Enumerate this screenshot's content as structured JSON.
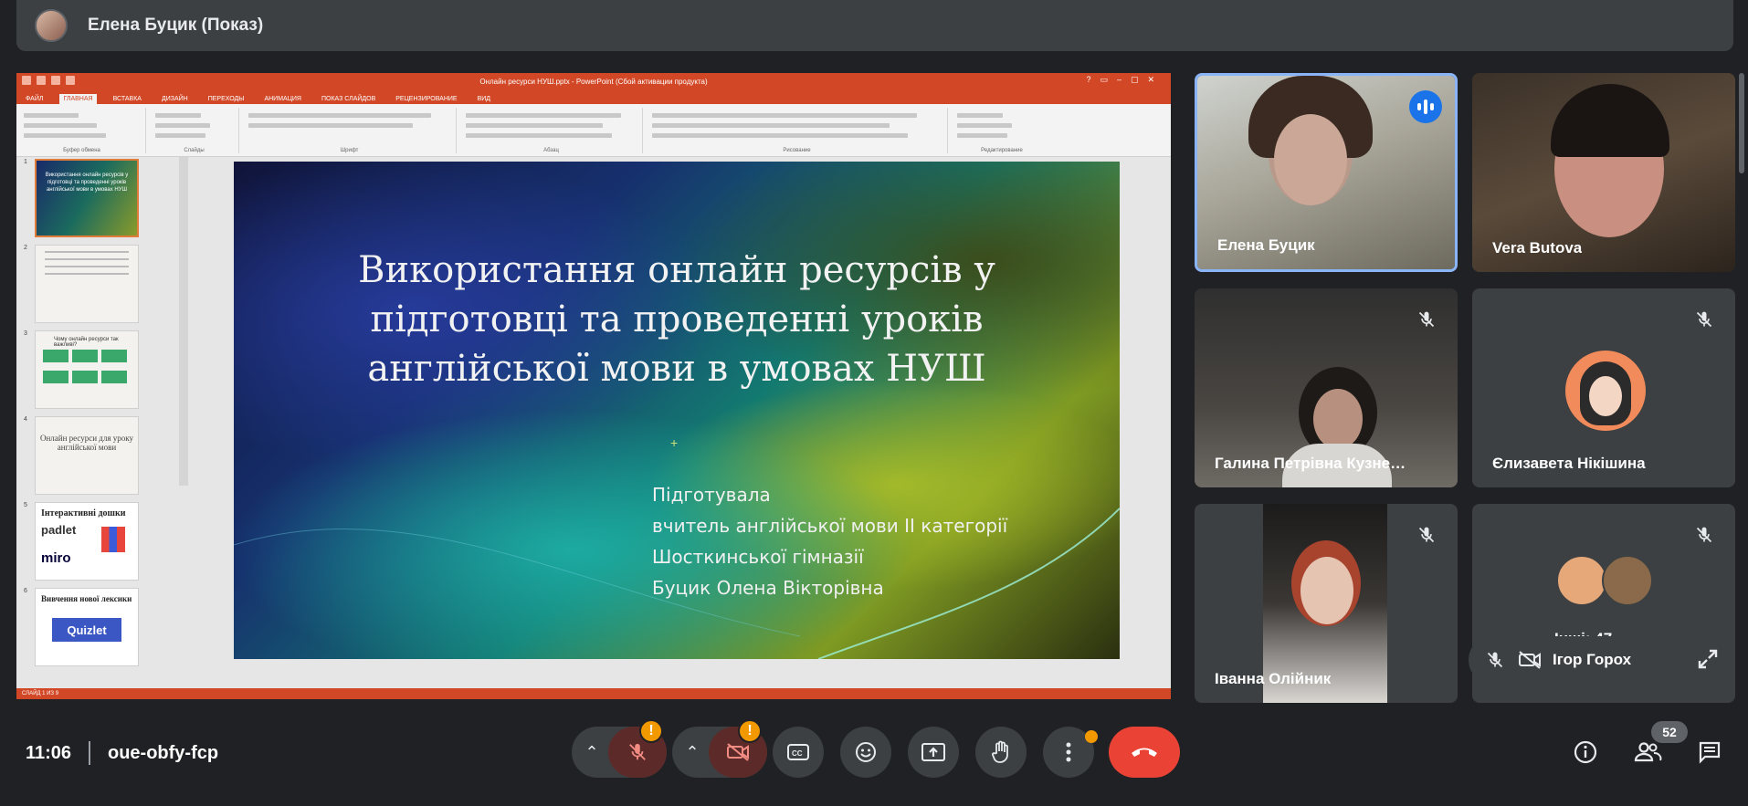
{
  "presenter": {
    "name": "Елена Буцик (Показ)"
  },
  "powerpoint": {
    "window_title": "Онлайн ресурси НУШ.pptx - PowerPoint (Сбой активации продукта)",
    "tabs": [
      "ФАЙЛ",
      "ГЛАВНАЯ",
      "ВСТАВКА",
      "ДИЗАЙН",
      "ПЕРЕХОДЫ",
      "АНИМАЦИЯ",
      "ПОКАЗ СЛАЙДОВ",
      "РЕЦЕНЗИРОВАНИЕ",
      "ВИД"
    ],
    "active_tab_index": 1,
    "ribbon_groups": [
      "Буфер обмена",
      "Слайды",
      "Шрифт",
      "Абзац",
      "Рисование",
      "Редактирование"
    ],
    "thumbnails": [
      {
        "number": "1",
        "text": "Використання онлайн ресурсів у підготовці та проведенні уроків англійської мови в умовах НУШ"
      },
      {
        "number": "2",
        "text": ""
      },
      {
        "number": "3",
        "text": "Чому онлайн ресурси так важливі?"
      },
      {
        "number": "4",
        "text": "Онлайн ресурси для уроку англійської мови"
      },
      {
        "number": "5",
        "text": "Інтерактивні дошки",
        "logos": [
          "padlet",
          "miro"
        ]
      },
      {
        "number": "6",
        "text": "Вивчення нової лексики",
        "logo": "Quizlet"
      }
    ],
    "status": "СЛАЙД 1 ИЗ 9",
    "slide": {
      "title": "Використання онлайн ресурсів у підготовці та проведенні уроків англійської мови в умовах НУШ",
      "subtitle_lines": [
        "Підготувала",
        "вчитель англійської мови ІІ категорії",
        "Шосткинської гімназії",
        "Буцик Олена Вікторівна"
      ]
    }
  },
  "participants": [
    {
      "name": "Елена Буцик",
      "speaking": true,
      "muted": false
    },
    {
      "name": "Vera Butova",
      "speaking": false,
      "muted": false
    },
    {
      "name": "Галина Петрівна Кузне…",
      "speaking": false,
      "muted": true
    },
    {
      "name": "Єлизавета Нікішина",
      "speaking": false,
      "muted": true
    },
    {
      "name": "Іванна Олійник",
      "speaking": false,
      "muted": true
    },
    {
      "name": "Інші: 47",
      "speaking": false,
      "muted": true
    }
  ],
  "self_view": {
    "name": "Ігор Горох"
  },
  "bottom_bar": {
    "time": "11:06",
    "meeting_code": "oue-obfy-fcp",
    "warning_symbol": "!",
    "participant_count": "52"
  },
  "colors": {
    "background": "#202124",
    "tile": "#3c4043",
    "end_call": "#ea4335",
    "warning": "#f29900",
    "speaking_border": "#8ab4f8",
    "powerpoint_accent": "#d24726"
  },
  "icons": [
    "mic-off-icon",
    "camera-off-icon",
    "captions-icon",
    "emoji-icon",
    "present-icon",
    "raise-hand-icon",
    "more-icon",
    "end-call-icon",
    "info-icon",
    "people-icon",
    "chat-icon",
    "expand-icon",
    "audio-level-icon"
  ]
}
